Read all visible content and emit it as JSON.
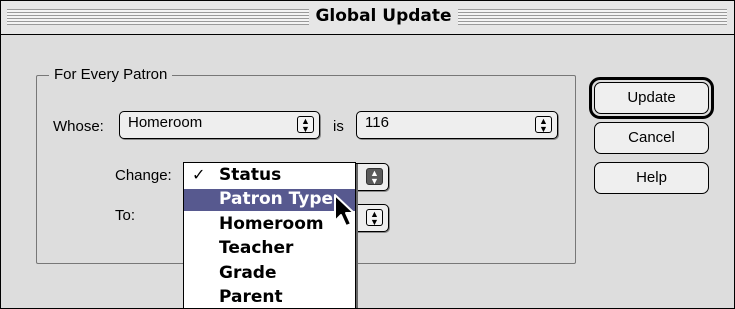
{
  "window": {
    "title": "Global Update"
  },
  "group": {
    "label": "For Every Patron"
  },
  "criteria": {
    "whose_label": "Whose:",
    "field_value": "Homeroom",
    "is_label": "is",
    "match_value": "116"
  },
  "change": {
    "label": "Change:",
    "to_label": "To:",
    "menu_items": [
      {
        "label": "Status",
        "checked": true
      },
      {
        "label": "Patron Type",
        "highlighted": true
      },
      {
        "label": "Homeroom"
      },
      {
        "label": "Teacher"
      },
      {
        "label": "Grade"
      },
      {
        "label": "Parent"
      }
    ]
  },
  "buttons": {
    "update": "Update",
    "cancel": "Cancel",
    "help": "Help"
  },
  "icons": {
    "popup_arrow": "up-down-arrows-icon",
    "checkmark": "checkmark-icon",
    "cursor": "arrow-cursor-icon"
  },
  "colors": {
    "highlight": "#57598f",
    "window_bg": "#dddddd"
  }
}
